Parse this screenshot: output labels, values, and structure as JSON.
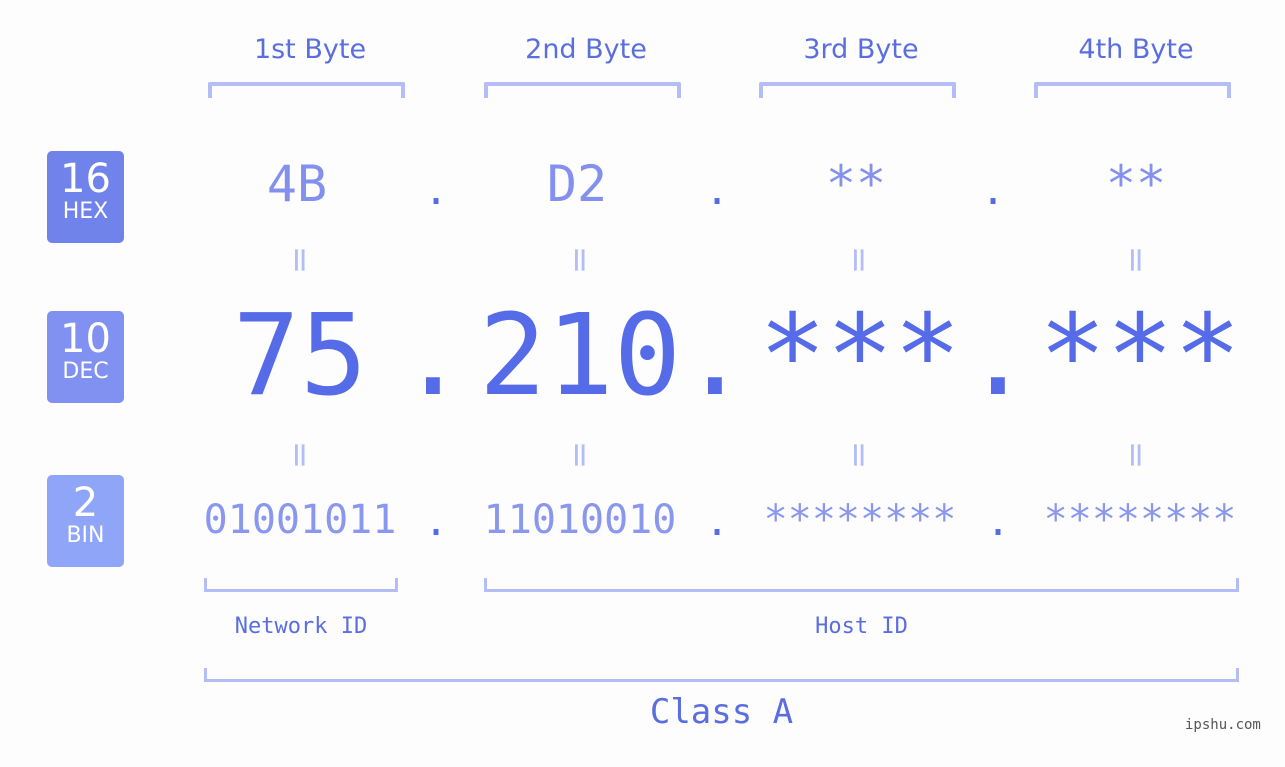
{
  "ip": {
    "hex": [
      "4B",
      "D2",
      "**",
      "**"
    ],
    "dec": [
      "75",
      "210",
      "***",
      "***"
    ],
    "bin": [
      "01001011",
      "11010010",
      "********",
      "********"
    ],
    "separator": ".",
    "equals": "="
  },
  "byte_headers": [
    "1st Byte",
    "2nd Byte",
    "3rd Byte",
    "4th Byte"
  ],
  "badges": [
    {
      "num": "16",
      "label": "HEX",
      "color": "#7083eb"
    },
    {
      "num": "10",
      "label": "DEC",
      "color": "#8191f1"
    },
    {
      "num": "2",
      "label": "BIN",
      "color": "#8fa5f8"
    }
  ],
  "segments": {
    "network_label": "Network ID",
    "host_label": "Host ID",
    "class_label": "Class A"
  },
  "watermark": "ipshu.com",
  "colors": {
    "accent": "#566be8",
    "bracket": "#b4bdf6",
    "hex_text": "#8390ee",
    "bin_text": "#8a97ef"
  }
}
